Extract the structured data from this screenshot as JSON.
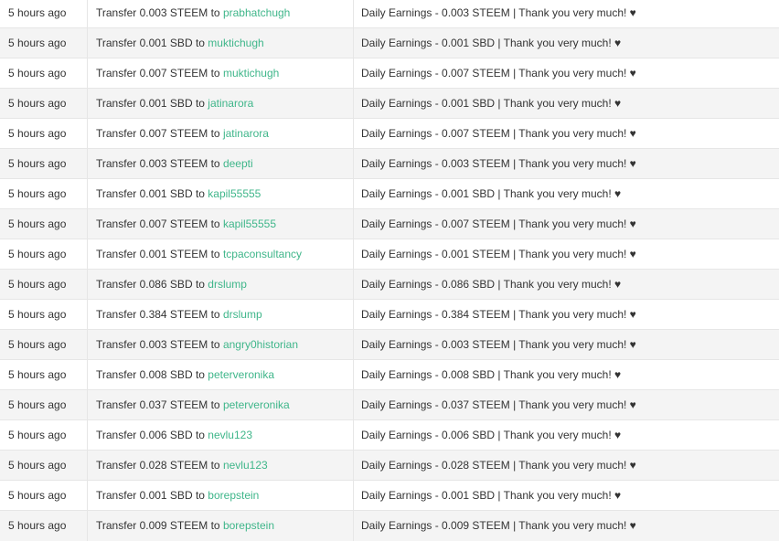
{
  "history": {
    "rows": [
      {
        "time": "5 hours ago",
        "op_prefix": "Transfer 0.003 STEEM to",
        "account": "prabhatchugh",
        "memo": "Daily Earnings - 0.003 STEEM | Thank you very much! ♥"
      },
      {
        "time": "5 hours ago",
        "op_prefix": "Transfer 0.001 SBD to",
        "account": "muktichugh",
        "memo": "Daily Earnings - 0.001 SBD | Thank you very much! ♥"
      },
      {
        "time": "5 hours ago",
        "op_prefix": "Transfer 0.007 STEEM to",
        "account": "muktichugh",
        "memo": "Daily Earnings - 0.007 STEEM | Thank you very much! ♥"
      },
      {
        "time": "5 hours ago",
        "op_prefix": "Transfer 0.001 SBD to",
        "account": "jatinarora",
        "memo": "Daily Earnings - 0.001 SBD | Thank you very much! ♥"
      },
      {
        "time": "5 hours ago",
        "op_prefix": "Transfer 0.007 STEEM to",
        "account": "jatinarora",
        "memo": "Daily Earnings - 0.007 STEEM | Thank you very much! ♥"
      },
      {
        "time": "5 hours ago",
        "op_prefix": "Transfer 0.003 STEEM to",
        "account": "deepti",
        "memo": "Daily Earnings - 0.003 STEEM | Thank you very much! ♥"
      },
      {
        "time": "5 hours ago",
        "op_prefix": "Transfer 0.001 SBD to",
        "account": "kapil55555",
        "memo": "Daily Earnings - 0.001 SBD | Thank you very much! ♥"
      },
      {
        "time": "5 hours ago",
        "op_prefix": "Transfer 0.007 STEEM to",
        "account": "kapil55555",
        "memo": "Daily Earnings - 0.007 STEEM | Thank you very much! ♥"
      },
      {
        "time": "5 hours ago",
        "op_prefix": "Transfer 0.001 STEEM to",
        "account": "tcpaconsultancy",
        "memo": "Daily Earnings - 0.001 STEEM | Thank you very much! ♥"
      },
      {
        "time": "5 hours ago",
        "op_prefix": "Transfer 0.086 SBD to",
        "account": "drslump",
        "memo": "Daily Earnings - 0.086 SBD | Thank you very much! ♥"
      },
      {
        "time": "5 hours ago",
        "op_prefix": "Transfer 0.384 STEEM to",
        "account": "drslump",
        "memo": "Daily Earnings - 0.384 STEEM | Thank you very much! ♥"
      },
      {
        "time": "5 hours ago",
        "op_prefix": "Transfer 0.003 STEEM to",
        "account": "angry0historian",
        "memo": "Daily Earnings - 0.003 STEEM | Thank you very much! ♥"
      },
      {
        "time": "5 hours ago",
        "op_prefix": "Transfer 0.008 SBD to",
        "account": "peterveronika",
        "memo": "Daily Earnings - 0.008 SBD | Thank you very much! ♥"
      },
      {
        "time": "5 hours ago",
        "op_prefix": "Transfer 0.037 STEEM to",
        "account": "peterveronika",
        "memo": "Daily Earnings - 0.037 STEEM | Thank you very much! ♥"
      },
      {
        "time": "5 hours ago",
        "op_prefix": "Transfer 0.006 SBD to",
        "account": "nevlu123",
        "memo": "Daily Earnings - 0.006 SBD | Thank you very much! ♥"
      },
      {
        "time": "5 hours ago",
        "op_prefix": "Transfer 0.028 STEEM to",
        "account": "nevlu123",
        "memo": "Daily Earnings - 0.028 STEEM | Thank you very much! ♥"
      },
      {
        "time": "5 hours ago",
        "op_prefix": "Transfer 0.001 SBD to",
        "account": "borepstein",
        "memo": "Daily Earnings - 0.001 SBD | Thank you very much! ♥"
      },
      {
        "time": "5 hours ago",
        "op_prefix": "Transfer 0.009 STEEM to",
        "account": "borepstein",
        "memo": "Daily Earnings - 0.009 STEEM | Thank you very much! ♥"
      }
    ]
  },
  "colors": {
    "link": "#3fb68a",
    "text": "#333333",
    "row_alt": "#f4f4f4",
    "row": "#ffffff",
    "border": "#e6e6e6"
  }
}
